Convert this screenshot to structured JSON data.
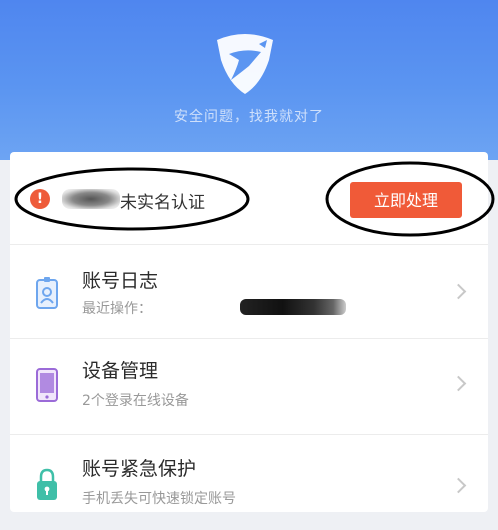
{
  "header": {
    "slogan": "安全问题，找我就对了",
    "logo_icon": "shield-plane-icon",
    "background_color": "#5b95f1"
  },
  "alert": {
    "icon": "exclamation-icon",
    "masked_name": "",
    "text": "未实名认证",
    "button_label": "立即处理",
    "accent_color": "#f05a38"
  },
  "items": [
    {
      "icon": "id-badge-icon",
      "title": "账号日志",
      "subtitle": "最近操作："
    },
    {
      "icon": "tablet-icon",
      "title": "设备管理",
      "subtitle": "2个登录在线设备"
    },
    {
      "icon": "lock-icon",
      "title": "账号紧急保护",
      "subtitle": "手机丢失可快速锁定账号"
    }
  ]
}
